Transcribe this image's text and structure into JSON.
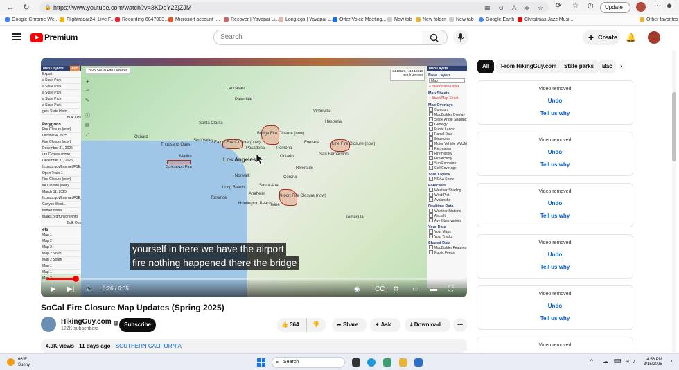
{
  "browser": {
    "url": "https://www.youtube.com/watch?v=3KDeY2ZjZJM",
    "update_label": "Update",
    "bookmarks": [
      "Google Chrome We...",
      "Flightradar24: Live F...",
      "Recording 6847083...",
      "Microsoft account |...",
      "Recover | Yavapai Li...",
      "Longlegs | Yavapai L...",
      "Otter Voice Meeting...",
      "New tab",
      "New folder",
      "New tab",
      "Google Earth",
      "Christmas Jazz Musi..."
    ],
    "other_favorites": "Other favorites"
  },
  "header": {
    "logo_text": "Premium",
    "search_placeholder": "Search",
    "create_label": "Create"
  },
  "player": {
    "map_title": "2025 SoCal Fire Closures",
    "coords_line1": "34.10527, -118.10810",
    "coords_line2": "453 ft   WGS84",
    "left_panel": {
      "header": "Map Objects",
      "add": "Add",
      "export": "Export",
      "rows": [
        "a State Park",
        "a State Park",
        "a State Park",
        "a State Park",
        "a State Park",
        "gers State Histo...",
        "Bulk Ops"
      ],
      "polygons_title": "Polygons",
      "polygon_rows": [
        "Fire Closure (now)",
        "October 4, 2025",
        "Fire Closure (now)",
        "December 31, 2025",
        "ure Closure (now)",
        "December 31, 2025",
        "fs.usda.gov/Internet/FSE...",
        "Open Trails 1",
        "Fire Closure (now)",
        "ire Closure (now)",
        "March 31, 2025",
        "fs.usda.gov/Internet/FSE_D...",
        "Canyon West...",
        "further notice",
        "tparks.org/runyon/#info",
        "Bulk Ops"
      ],
      "sets_title": "ets",
      "set_rows": [
        "Map 1",
        "Map 2",
        "Map 2",
        "Map 2 North",
        "Map 2 South",
        "Map 1",
        "Map 1",
        "Map 2"
      ]
    },
    "right_panel": {
      "header": "Map Layers",
      "base_layers": "Base Layers",
      "base_value": "Map",
      "stack_base": "+ Stack Base Layer",
      "map_sheets": "Map Sheets",
      "stack_sheet": "+ Stack Map Sheet",
      "overlays_title": "Map Overlays",
      "overlays": [
        "Contours",
        "MapBuilder Overlay",
        "Slope Angle Shading",
        "Geology",
        "Public Lands",
        "Parcel Data",
        "Structures",
        "Motor Vehicle MVUM",
        "Recreation",
        "Fire History",
        "Fire Activity",
        "Sun Exposure",
        "Cell Coverage"
      ],
      "your_layers_title": "Your Layers",
      "your_layers": [
        "NOAA Snow"
      ],
      "forecasts_title": "Forecasts",
      "forecasts": [
        "Weather Shading",
        "Wind Plot",
        "Avalanche"
      ],
      "realtime_title": "Realtime Data",
      "realtime": [
        "Weather Stations",
        "Aircraft",
        "Avy Observations"
      ],
      "your_data_title": "Your Data",
      "your_data": [
        "Your Maps",
        "Your Tracks"
      ],
      "shared_title": "Shared Data",
      "shared": [
        "MapBuilder Features",
        "Public Feeds"
      ]
    },
    "map_labels": [
      "Lancaster",
      "Palmdale",
      "Santa Clarita",
      "Simi Valley",
      "Thousand Oaks",
      "Malibu",
      "Los Angeles",
      "Pasadena",
      "San Bernardino",
      "Riverside",
      "Long Beach",
      "Anaheim",
      "Irvine",
      "Ontario",
      "Torrance",
      "Huntington Beach",
      "Oxnard",
      "Fontana",
      "Temecula",
      "Santa Ana",
      "Norwalk",
      "Pomona",
      "Victorville",
      "Hesperia",
      "Corona"
    ],
    "fire_labels": [
      "Bridge Fire Closure (now)",
      "Eaton Fire Closure (now)",
      "Airport Fire Closure (now)",
      "Line Fire Closure (now)",
      "Palisades Fire"
    ],
    "caption_line1": "yourself in here we have the airport",
    "caption_line2": "fire nothing happened there the bridge",
    "time": "0:26 / 6:05",
    "progress": 0.07
  },
  "video": {
    "title": "SoCal Fire Closure Map Updates (Spring 2025)",
    "channel": "HikingGuy.com",
    "subscribers": "122K subscribers",
    "subscribe_label": "Subscribe",
    "likes": "364",
    "share_label": "Share",
    "ask_label": "Ask",
    "download_label": "Download",
    "views": "4.9K views",
    "age": "11 days ago",
    "location_tag": "SOUTHERN CALIFORNIA"
  },
  "sidebar": {
    "chips": [
      "All",
      "From HikingGuy.com",
      "State parks",
      "Bac"
    ],
    "removed_cards": [
      {
        "text": "Video removed",
        "undo": "Undo",
        "why": "Tell us why"
      },
      {
        "text": "Video removed",
        "undo": "Undo",
        "why": "Tell us why"
      },
      {
        "text": "Video removed",
        "undo": "Undo",
        "why": "Tell us why"
      },
      {
        "text": "Video removed",
        "undo": "Undo",
        "why": "Tell us why"
      },
      {
        "text": "Video removed",
        "undo": "Undo",
        "why": "Tell us why"
      },
      {
        "text": "Video removed"
      }
    ]
  },
  "taskbar": {
    "temp": "66°F",
    "condition": "Sunny",
    "search_placeholder": "Search",
    "time": "4:56 PM",
    "date": "3/15/2025"
  },
  "colors": {
    "youtube_red": "#ff0000",
    "link_blue": "#065fd4",
    "panel_navy": "#2d3f6f"
  }
}
